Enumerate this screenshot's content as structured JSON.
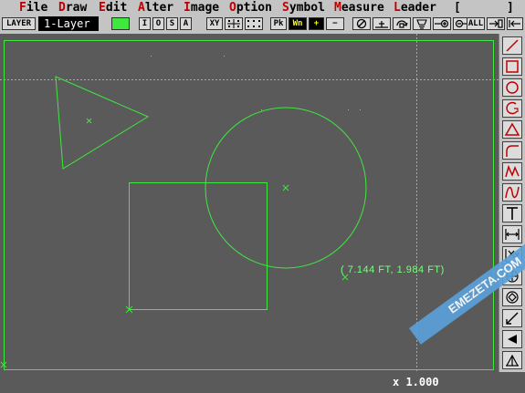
{
  "menu": {
    "items": [
      {
        "hotkey": "F",
        "rest": "ile"
      },
      {
        "hotkey": "D",
        "rest": "raw"
      },
      {
        "hotkey": "E",
        "rest": "dit"
      },
      {
        "hotkey": "A",
        "rest": "lter"
      },
      {
        "hotkey": "I",
        "rest": "mage"
      },
      {
        "hotkey": "O",
        "rest": "ption"
      },
      {
        "hotkey": "S",
        "rest": "ymbol"
      },
      {
        "hotkey": "M",
        "rest": "easure"
      },
      {
        "hotkey": "L",
        "rest": "eader"
      }
    ],
    "bracket_left": "[",
    "bracket_right": "]"
  },
  "toolbar": {
    "layer_label": "LAYER",
    "layer_name": "1-Layer",
    "layer_color": "#3fe83f",
    "snap_buttons": [
      "I",
      "O",
      "S",
      "A"
    ],
    "xy_button": "XY",
    "pk_button": "Pk",
    "wn_button": "Wn",
    "plus_button": "+",
    "minus_button": "−",
    "all_button": "ALL"
  },
  "canvas": {
    "coord_readout": "( 7.144 FT, 1.984 FT)",
    "line_color": "#3fe83f",
    "background": "#5a5a5a"
  },
  "status": {
    "zoom": "x 1.000"
  },
  "watermark": "EMEZETA.COM",
  "palette_tools": [
    "line",
    "rectangle",
    "circle",
    "arc",
    "polygon",
    "fillet",
    "polyline",
    "spline",
    "text",
    "dimension",
    "xy-point",
    "ellipse",
    "bisect",
    "leader",
    "arrowhead",
    "area"
  ]
}
